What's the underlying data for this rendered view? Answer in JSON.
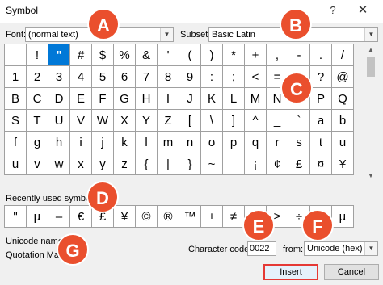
{
  "window": {
    "title": "Symbol",
    "help_glyph": "?",
    "close_glyph": "✕"
  },
  "font": {
    "label": "Font:",
    "value": "(normal text)"
  },
  "subset": {
    "label": "Subset:",
    "value": "Basic Latin"
  },
  "symbols": [
    " ",
    "!",
    "\"",
    "#",
    "$",
    "%",
    "&",
    "'",
    "(",
    ")",
    "*",
    "+",
    ",",
    "-",
    ".",
    "/",
    "1",
    "2",
    "3",
    "4",
    "5",
    "6",
    "7",
    "8",
    "9",
    ":",
    ";",
    "<",
    "=",
    ">",
    "?",
    "@",
    "B",
    "C",
    "D",
    "E",
    "F",
    "G",
    "H",
    "I",
    "J",
    "K",
    "L",
    "M",
    "N",
    "O",
    "P",
    "Q",
    "S",
    "T",
    "U",
    "V",
    "W",
    "X",
    "Y",
    "Z",
    "[",
    "\\",
    "]",
    "^",
    "_",
    "`",
    "a",
    "b",
    "f",
    "g",
    "h",
    "i",
    "j",
    "k",
    "l",
    "m",
    "n",
    "o",
    "p",
    "q",
    "r",
    "s",
    "t",
    "u",
    "u",
    "v",
    "w",
    "x",
    "y",
    "z",
    "{",
    "|",
    "}",
    "~",
    "",
    "¡",
    "¢",
    "£",
    "¤",
    "¥"
  ],
  "selected_index": 2,
  "recent": {
    "label": "Recently used symbols:",
    "symbols": [
      "\"",
      "µ",
      "–",
      "€",
      "£",
      "¥",
      "©",
      "®",
      "™",
      "±",
      "≠",
      "≤",
      "≥",
      "÷",
      "∞",
      "µ"
    ]
  },
  "unicode": {
    "name_label": "Unicode name:",
    "name_value": "Quotation Mark"
  },
  "char_code": {
    "label": "Character code:",
    "value": "0022"
  },
  "from": {
    "label": "from:",
    "value": "Unicode (hex)"
  },
  "buttons": {
    "insert": "Insert",
    "cancel": "Cancel"
  },
  "scrollbar": {
    "up_glyph": "▲",
    "down_glyph": "▼"
  },
  "combo_arrow": "▼",
  "annotations": [
    "A",
    "B",
    "C",
    "D",
    "E",
    "F",
    "G"
  ],
  "colors": {
    "selection": "#0078d7",
    "annotation": "#ea4f2d",
    "highlight_border": "#e53935"
  }
}
